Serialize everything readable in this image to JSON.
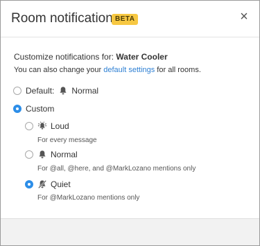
{
  "dialog": {
    "title": "Room notifications",
    "badge": "BETA",
    "close_label": "×"
  },
  "intro": {
    "prefix": "Customize notifications for:",
    "room": "Water Cooler"
  },
  "subtext": {
    "before": "You can also change your ",
    "link": "default settings",
    "after": " for all rooms."
  },
  "options": {
    "default": {
      "label": "Default:",
      "value": "Normal",
      "selected": false
    },
    "custom": {
      "label": "Custom",
      "selected": true
    }
  },
  "custom_levels": [
    {
      "label": "Loud",
      "help": "For every message",
      "selected": false,
      "icon": "bell-loud-icon"
    },
    {
      "label": "Normal",
      "help": "For @all, @here, and @MarkLozano mentions only",
      "selected": false,
      "icon": "bell-icon"
    },
    {
      "label": "Quiet",
      "help": "For @MarkLozano mentions only",
      "selected": true,
      "icon": "bell-muted-icon"
    }
  ],
  "colors": {
    "accent": "#2d8ee8",
    "link": "#2d7fd3",
    "badge": "#f7c842"
  }
}
